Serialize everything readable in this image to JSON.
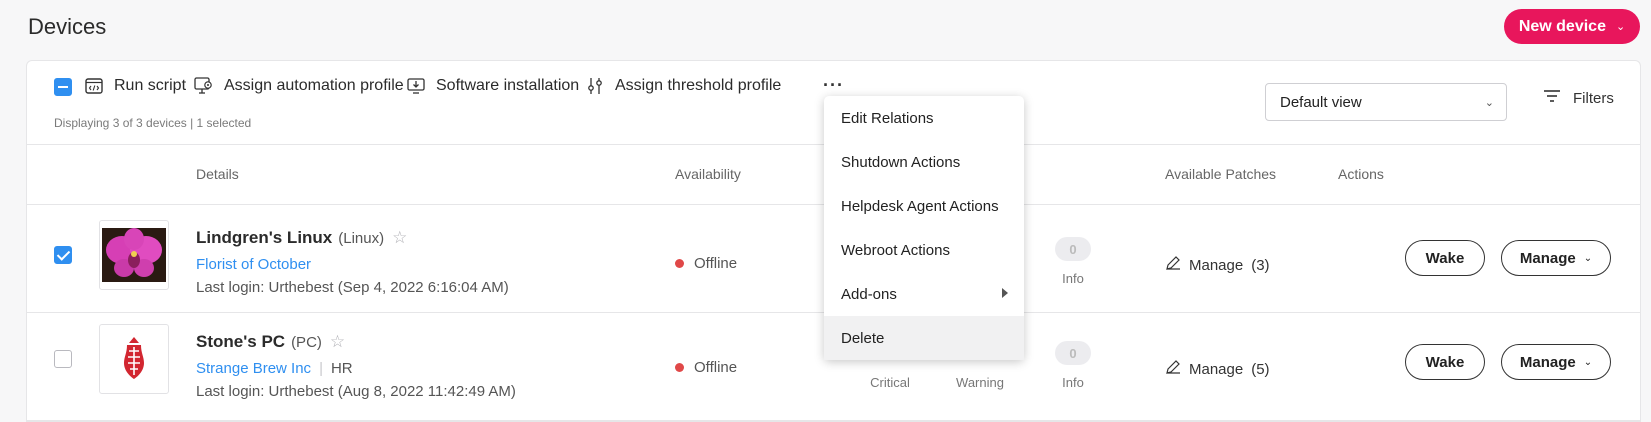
{
  "header": {
    "title": "Devices",
    "new_device_label": "New device"
  },
  "toolbar": {
    "run_script": "Run script",
    "assign_automation_profile": "Assign automation profile",
    "software_installation": "Software installation",
    "assign_threshold_profile": "Assign threshold profile",
    "more": "···",
    "display_count": "Displaying 3 of 3 devices | 1 selected",
    "view_select": "Default view",
    "filters": "Filters"
  },
  "table": {
    "columns": [
      "Details",
      "Availability",
      "Available Patches",
      "Actions"
    ],
    "rows": [
      {
        "selected": true,
        "name": "Lindgren's Linux",
        "type": "(Linux)",
        "org": "Florist of October",
        "dept": "",
        "last_login": "Last login: Urthebest (Sep 4, 2022 6:16:04 AM)",
        "availability": "Offline",
        "info_count": "0",
        "info_label": "Info",
        "patches_label": "Manage",
        "patches_count": "(3)",
        "wake": "Wake",
        "manage": "Manage"
      },
      {
        "selected": false,
        "name": "Stone's PC",
        "type": "(PC)",
        "org": "Strange Brew Inc",
        "dept": "HR",
        "last_login": "Last login: Urthebest (Aug 8, 2022 11:42:49 AM)",
        "availability": "Offline",
        "critical_label": "Critical",
        "warning_label": "Warning",
        "info_count": "0",
        "info_label": "Info",
        "patches_label": "Manage",
        "patches_count": "(5)",
        "wake": "Wake",
        "manage": "Manage"
      }
    ]
  },
  "menu": {
    "items": [
      "Edit Relations",
      "Shutdown Actions",
      "Helpdesk Agent Actions",
      "Webroot Actions",
      "Add-ons",
      "Delete"
    ]
  },
  "colors": {
    "accent": "#e8165c",
    "checkbox": "#2f8ff0",
    "link": "#2f8ff0",
    "offline": "#e04848"
  }
}
